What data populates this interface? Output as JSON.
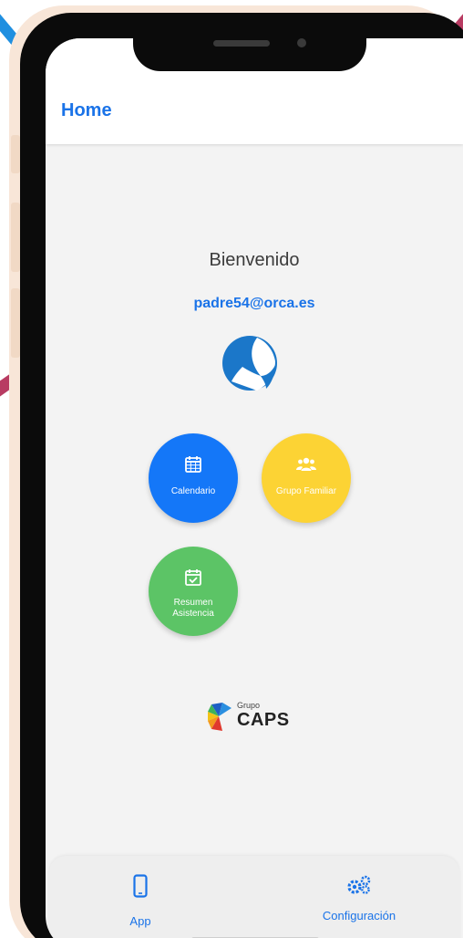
{
  "header": {
    "title": "Home"
  },
  "welcome": {
    "greeting": "Bienvenido",
    "email": "padre54@orca.es"
  },
  "actions": [
    {
      "label": "Calendario",
      "icon": "calendar-icon",
      "color": "#1477f8"
    },
    {
      "label": "Grupo Familiar",
      "icon": "users-icon",
      "color": "#fcd334"
    },
    {
      "label": "Resumen Asistencia",
      "icon": "calendar-check-icon",
      "color": "#5cc466"
    }
  ],
  "brand": {
    "small": "Grupo",
    "big": "CAPS"
  },
  "bottom_nav": {
    "items": [
      {
        "label": "App",
        "icon": "mobile-phone-icon"
      },
      {
        "label": "Configuración",
        "icon": "gears-icon"
      }
    ]
  },
  "colors": {
    "accent": "#1a73e8",
    "background": "#f3f3f3"
  }
}
